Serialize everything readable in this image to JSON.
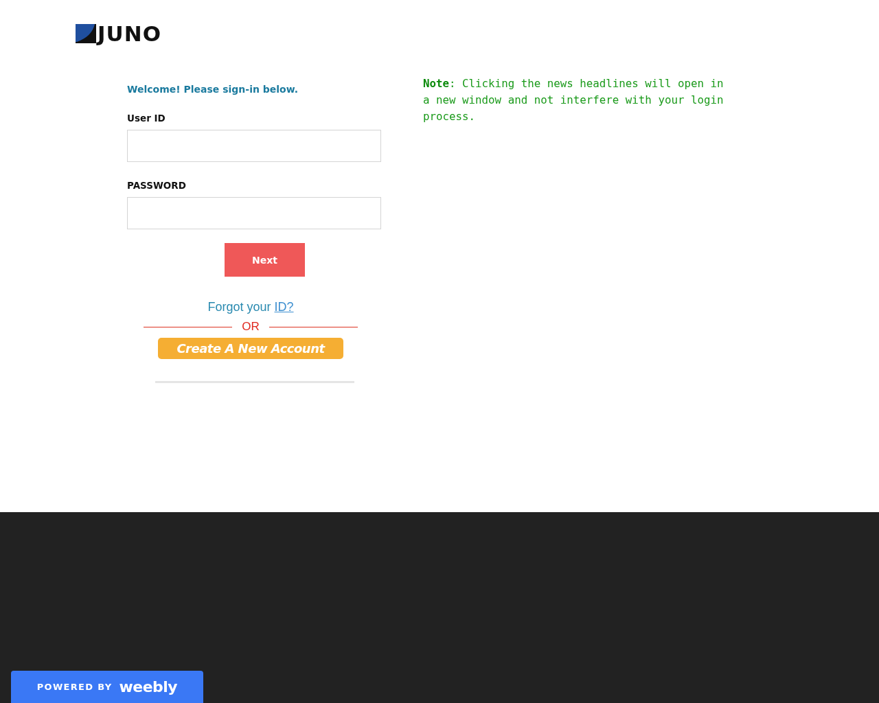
{
  "logo": {
    "text": "JUNO"
  },
  "login": {
    "welcome": "Welcome! Please sign-in below.",
    "fields": [
      {
        "label": "User ID"
      },
      {
        "label": "PASSWORD"
      }
    ],
    "next_button": "Next",
    "forgot": {
      "text": "Forgot your",
      "link": "ID?"
    },
    "separator": "OR",
    "create_account": "Create A New Account"
  },
  "note": "**Note**: Clicking the news headlines will open in a new window and not interfere with your login process.",
  "badge": {
    "prefix": "POWERED BY",
    "brand": "weebly"
  }
}
